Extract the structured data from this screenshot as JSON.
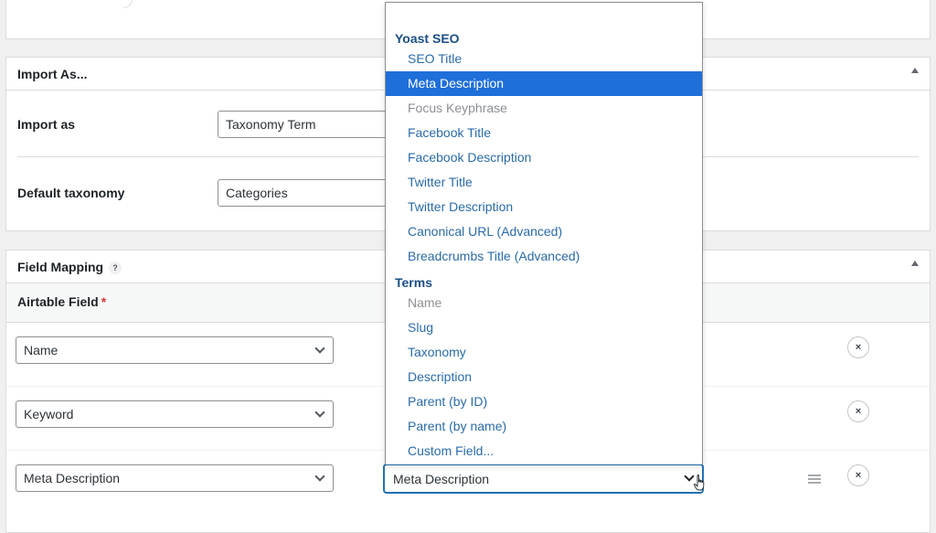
{
  "import_panel": {
    "title": "Import As...",
    "import_as_label": "Import as",
    "import_as_value": "Taxonomy Term",
    "default_taxonomy_label": "Default taxonomy",
    "default_taxonomy_value": "Categories"
  },
  "mapping_panel": {
    "title": "Field Mapping",
    "help_badge": "?",
    "airtable_field_header": "Airtable Field",
    "required_marker": "*",
    "rows": [
      {
        "airtable_field": "Name"
      },
      {
        "airtable_field": "Keyword"
      },
      {
        "airtable_field": "Meta Description",
        "target_field": "Meta Description"
      }
    ],
    "remove_label": "×"
  },
  "dropdown": {
    "groups": [
      {
        "label": "Yoast SEO",
        "options": [
          {
            "label": "SEO Title",
            "state": "normal"
          },
          {
            "label": "Meta Description",
            "state": "selected"
          },
          {
            "label": "Focus Keyphrase",
            "state": "disabled"
          },
          {
            "label": "Facebook Title",
            "state": "normal"
          },
          {
            "label": "Facebook Description",
            "state": "normal"
          },
          {
            "label": "Twitter Title",
            "state": "normal"
          },
          {
            "label": "Twitter Description",
            "state": "normal"
          },
          {
            "label": "Canonical URL (Advanced)",
            "state": "normal"
          },
          {
            "label": "Breadcrumbs Title (Advanced)",
            "state": "normal"
          }
        ]
      },
      {
        "label": "Terms",
        "options": [
          {
            "label": "Name",
            "state": "disabled"
          },
          {
            "label": "Slug",
            "state": "normal"
          },
          {
            "label": "Taxonomy",
            "state": "normal"
          },
          {
            "label": "Description",
            "state": "normal"
          },
          {
            "label": "Parent (by ID)",
            "state": "normal"
          },
          {
            "label": "Parent (by name)",
            "state": "normal"
          },
          {
            "label": "Custom Field...",
            "state": "normal"
          }
        ]
      }
    ]
  },
  "icons": {
    "collapse": "chevron-up-icon",
    "select_arrow": "chevron-down-icon",
    "remove": "close-icon",
    "drag": "drag-handle-icon",
    "cursor": "hand-pointer-icon"
  },
  "colors": {
    "accent": "#2271b1",
    "selected_option_bg": "#1e6fd9",
    "group_label": "#1a4f86",
    "option_text": "#2a6ba8",
    "required": "#d63638"
  }
}
